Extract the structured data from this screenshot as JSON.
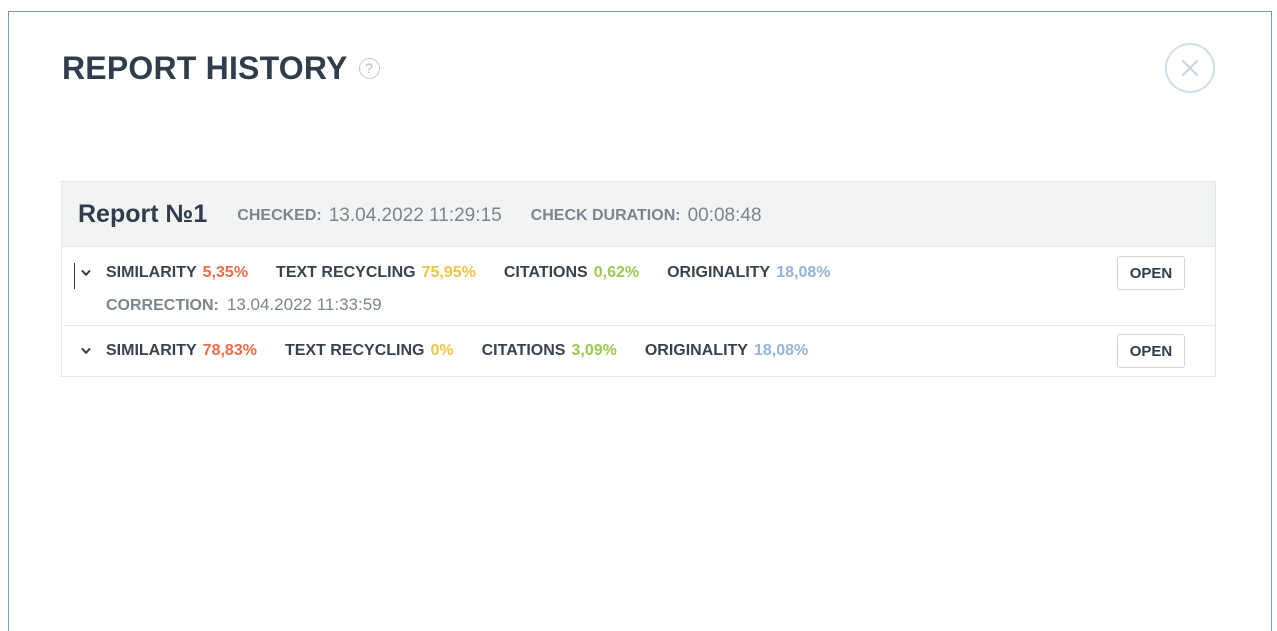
{
  "modal": {
    "title": "REPORT HISTORY",
    "help_icon": "?",
    "close_icon": "close-icon"
  },
  "report": {
    "name": "Report №1",
    "checked_label": "CHECKED:",
    "checked_value": "13.04.2022 11:29:15",
    "duration_label": "CHECK DURATION:",
    "duration_value": "00:08:48"
  },
  "rows": [
    {
      "similarity_label": "SIMILARITY",
      "similarity_value": "5,35%",
      "recycling_label": "TEXT RECYCLING",
      "recycling_value": "75,95%",
      "citations_label": "CITATIONS",
      "citations_value": "0,62%",
      "originality_label": "ORIGINALITY",
      "originality_value": "18,08%",
      "correction_label": "CORRECTION:",
      "correction_value": "13.04.2022 11:33:59",
      "open_label": "OPEN"
    },
    {
      "similarity_label": "SIMILARITY",
      "similarity_value": "78,83%",
      "recycling_label": "TEXT RECYCLING",
      "recycling_value": "0%",
      "citations_label": "CITATIONS",
      "citations_value": "3,09%",
      "originality_label": "ORIGINALITY",
      "originality_value": "18,08%",
      "open_label": "OPEN"
    }
  ],
  "colors": {
    "similarity": "#ee6b47",
    "recycling": "#f5c142",
    "citations": "#9cc94f",
    "originality": "#94b4d3"
  }
}
